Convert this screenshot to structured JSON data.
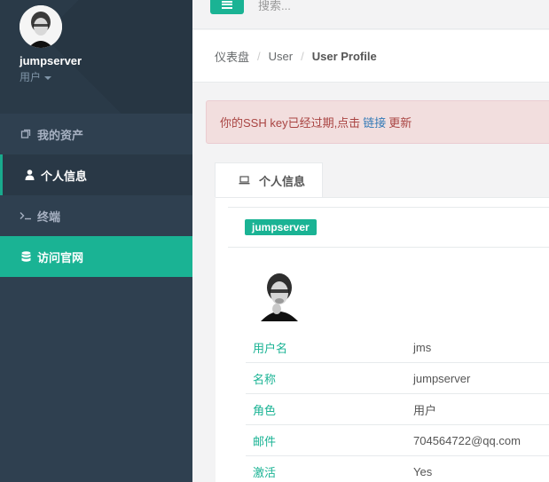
{
  "profile": {
    "username": "jumpserver",
    "role": "用户"
  },
  "sidebar": {
    "items": [
      {
        "label": "我的资产",
        "icon": "assets-icon"
      },
      {
        "label": "个人信息",
        "icon": "user-icon"
      },
      {
        "label": "终端",
        "icon": "terminal-icon"
      },
      {
        "label": "访问官网",
        "icon": "database-icon"
      }
    ],
    "active_index": 1,
    "accent_color": "#1ab394"
  },
  "topbar": {
    "search_placeholder": "搜索..."
  },
  "breadcrumb": {
    "items": [
      "仪表盘",
      "User",
      "User Profile"
    ]
  },
  "alert": {
    "prefix": "你的SSH key已经过期,点击",
    "link": "链接",
    "suffix": "更新"
  },
  "tab": {
    "label": "个人信息",
    "icon": "laptop-icon"
  },
  "panel": {
    "badge": "jumpserver",
    "fields": [
      {
        "key": "用户名",
        "value": "jms"
      },
      {
        "key": "名称",
        "value": "jumpserver"
      },
      {
        "key": "角色",
        "value": "用户"
      },
      {
        "key": "邮件",
        "value": "704564722@qq.com"
      },
      {
        "key": "激活",
        "value": "Yes"
      }
    ]
  }
}
